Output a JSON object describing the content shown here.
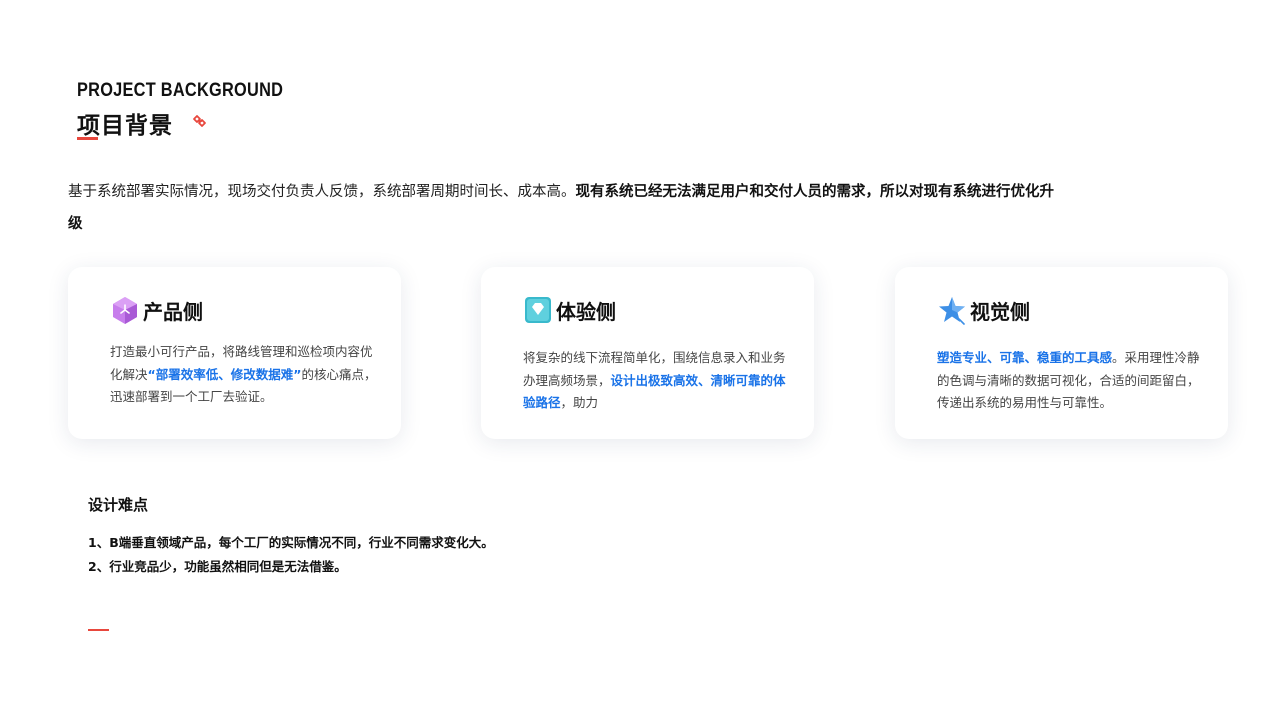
{
  "header": {
    "title_en": "PROJECT BACKGROUND",
    "title_cn": "项目背景",
    "icon": "red-link-icon",
    "accent_color": "#e8473d"
  },
  "intro": {
    "normal": "基于系统部署实际情况，现场交付负责人反馈，系统部署周期时间长、成本高。",
    "bold": "现有系统已经无法满足用户和交付人员的需求，所以对现有系统进行优化升级"
  },
  "cards": [
    {
      "title": "产品侧",
      "icon": "purple-cube-icon",
      "text_before": "打造最小可行产品，将路线管理和巡检项内容优化解决",
      "highlight": "“部署效率低、修改数据难”",
      "text_after": "的核心痛点，迅速部署到一个工厂去验证。"
    },
    {
      "title": "体验侧",
      "icon": "teal-diamond-icon",
      "text_before": "将复杂的线下流程简单化，围绕信息录入和业务办理高频场景，",
      "highlight": "设计出极致高效、清晰可靠的体验路径",
      "text_after": "，助力"
    },
    {
      "title": "视觉侧",
      "icon": "blue-star-icon",
      "text_before": "",
      "highlight": "塑造专业、可靠、稳重的工具感",
      "text_after": "。采用理性冷静的色调与清晰的数据可视化，合适的间距留白，传递出系统的易用性与可靠性。"
    }
  ],
  "difficulties": {
    "title": "设计难点",
    "items": [
      "1、B端垂直领域产品，每个工厂的实际情况不同，行业不同需求变化大。",
      "2、行业竞品少，功能虽然相同但是无法借鉴。"
    ]
  },
  "colors": {
    "highlight": "#1a73e8",
    "accent": "#e8473d"
  }
}
